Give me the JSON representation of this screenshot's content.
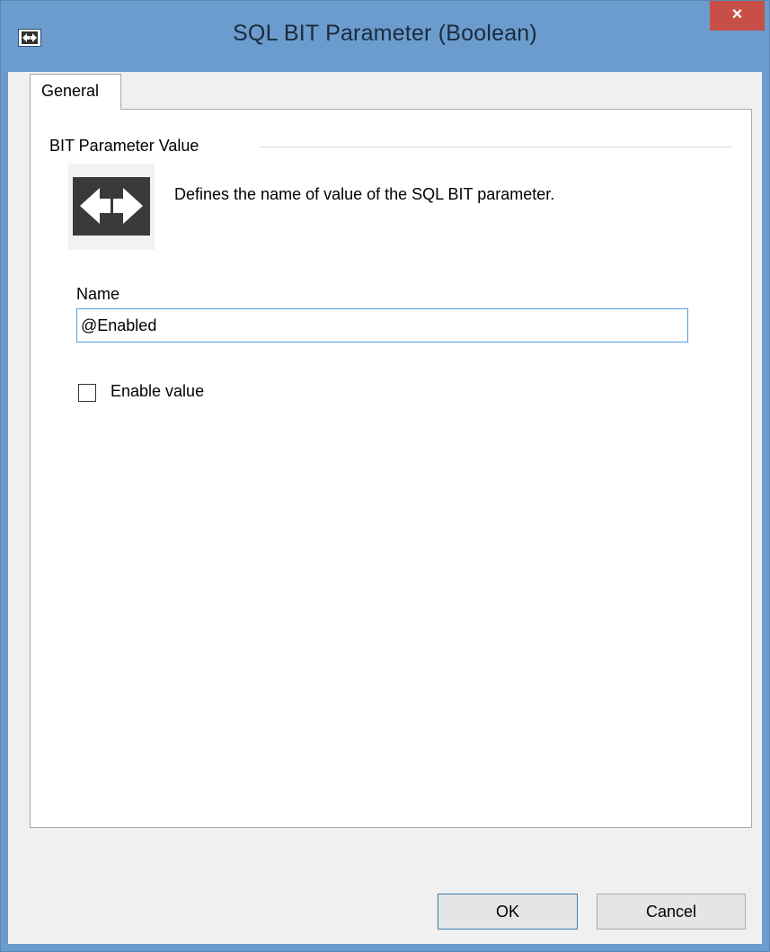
{
  "window": {
    "title": "SQL BIT Parameter (Boolean)",
    "close_glyph": "×",
    "app_icon": "parameter-arrows-icon"
  },
  "tabs": [
    {
      "label": "General",
      "selected": true
    }
  ],
  "group": {
    "title": "BIT Parameter Value",
    "icon": "parameter-arrows-icon",
    "description": "Defines the name of value of the SQL BIT parameter."
  },
  "name_field": {
    "label": "Name",
    "value": "@Enabled"
  },
  "enable_checkbox": {
    "label": "Enable value",
    "checked": false
  },
  "buttons": {
    "ok_label": "OK",
    "cancel_label": "Cancel"
  },
  "colors": {
    "titlebar": "#6b9ccd",
    "close_button": "#c74f48",
    "input_focus_border": "#569de5",
    "dialog_background": "#f0f0f0"
  }
}
